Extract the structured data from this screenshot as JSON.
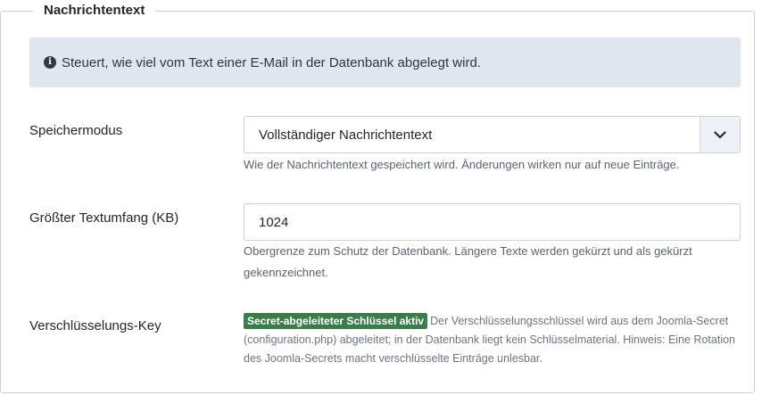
{
  "section": {
    "legend": "Nachrichtentext",
    "info_text": "Steuert, wie viel vom Text einer E-Mail in der Datenbank abgelegt wird."
  },
  "storage_mode": {
    "label": "Speichermodus",
    "selected": "Vollständiger Nachrichtentext",
    "help": "Wie der Nachrichtentext gespeichert wird. Änderungen wirken nur auf neue Einträge."
  },
  "max_size": {
    "label": "Größter Textumfang (KB)",
    "value": "1024",
    "help": "Obergrenze zum Schutz der Datenbank. Längere Texte werden gekürzt und als gekürzt gekennzeichnet."
  },
  "encryption": {
    "label": "Verschlüsselungs-Key",
    "badge": "Secret-abgeleiteter Schlüssel aktiv",
    "description": "Der Verschlüsselungsschlüssel wird aus dem Joomla-Secret (configuration.php) abgeleitet; in der Datenbank liegt kein Schlüsselmaterial. Hinweis: Eine Rotation des Joomla-Secrets macht verschlüsselte Einträge unlesbar.",
    "badge_color": "#3b7d4a"
  },
  "icons": {
    "info": "info-circle-icon",
    "select": "chevron-down-icon"
  }
}
